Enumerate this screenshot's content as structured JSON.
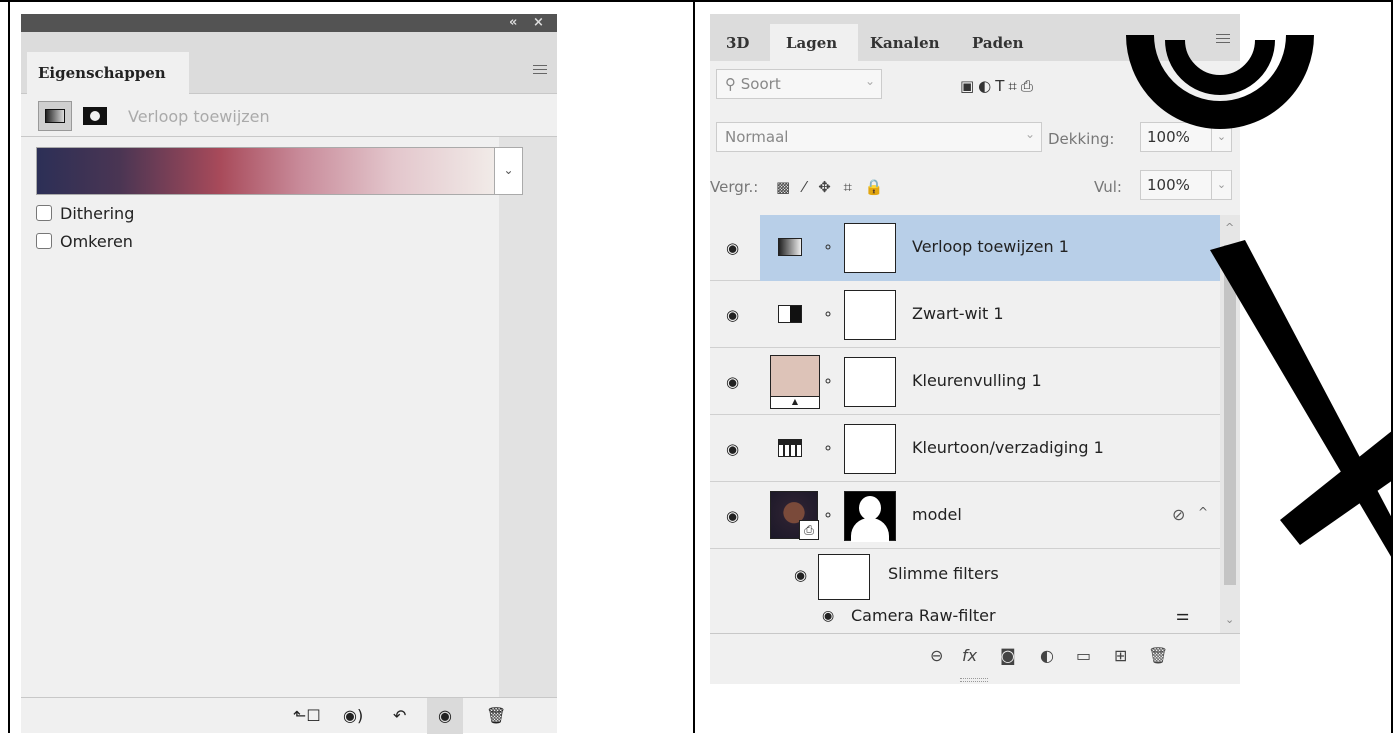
{
  "properties_panel": {
    "collapse_icon": "«",
    "close_icon": "×",
    "tab_label": "Eigenschappen",
    "adjustment_title": "Verloop toewijzen",
    "gradient_colors": [
      "#2c2f56",
      "#a84a5a",
      "#e3c6cc",
      "#f1ebe8"
    ],
    "options": [
      {
        "label": "Dithering",
        "checked": false
      },
      {
        "label": "Omkeren",
        "checked": false
      }
    ],
    "bottom_icons": [
      "clip-to-layer-icon",
      "view-previous-state-icon",
      "reset-icon",
      "toggle-visibility-icon",
      "delete-icon"
    ]
  },
  "layers_panel": {
    "tabs": [
      {
        "label": "3D",
        "active": false
      },
      {
        "label": "Lagen",
        "active": true
      },
      {
        "label": "Kanalen",
        "active": false
      },
      {
        "label": "Paden",
        "active": false
      }
    ],
    "filter_kind": "Soort",
    "blend_mode": "Normaal",
    "opacity_label": "Dekking:",
    "opacity_value": "100%",
    "lock_label": "Vergr.:",
    "fill_label": "Vul:",
    "fill_value": "100%",
    "layers": [
      {
        "name": "Verloop toewijzen 1",
        "type": "gradient-map",
        "selected": true
      },
      {
        "name": "Zwart-wit 1",
        "type": "black-white",
        "selected": false
      },
      {
        "name": "Kleurenvulling 1",
        "type": "color-fill",
        "fill_color": "#ddc3b8",
        "selected": false
      },
      {
        "name": "Kleurtoon/verzadiging 1",
        "type": "hue-saturation",
        "selected": false
      },
      {
        "name": "model",
        "type": "smart-object",
        "selected": false
      }
    ],
    "smart_filters_label": "Slimme filters",
    "camera_raw_label": "Camera Raw-filter",
    "accent_selected": "#b8cfe8"
  }
}
